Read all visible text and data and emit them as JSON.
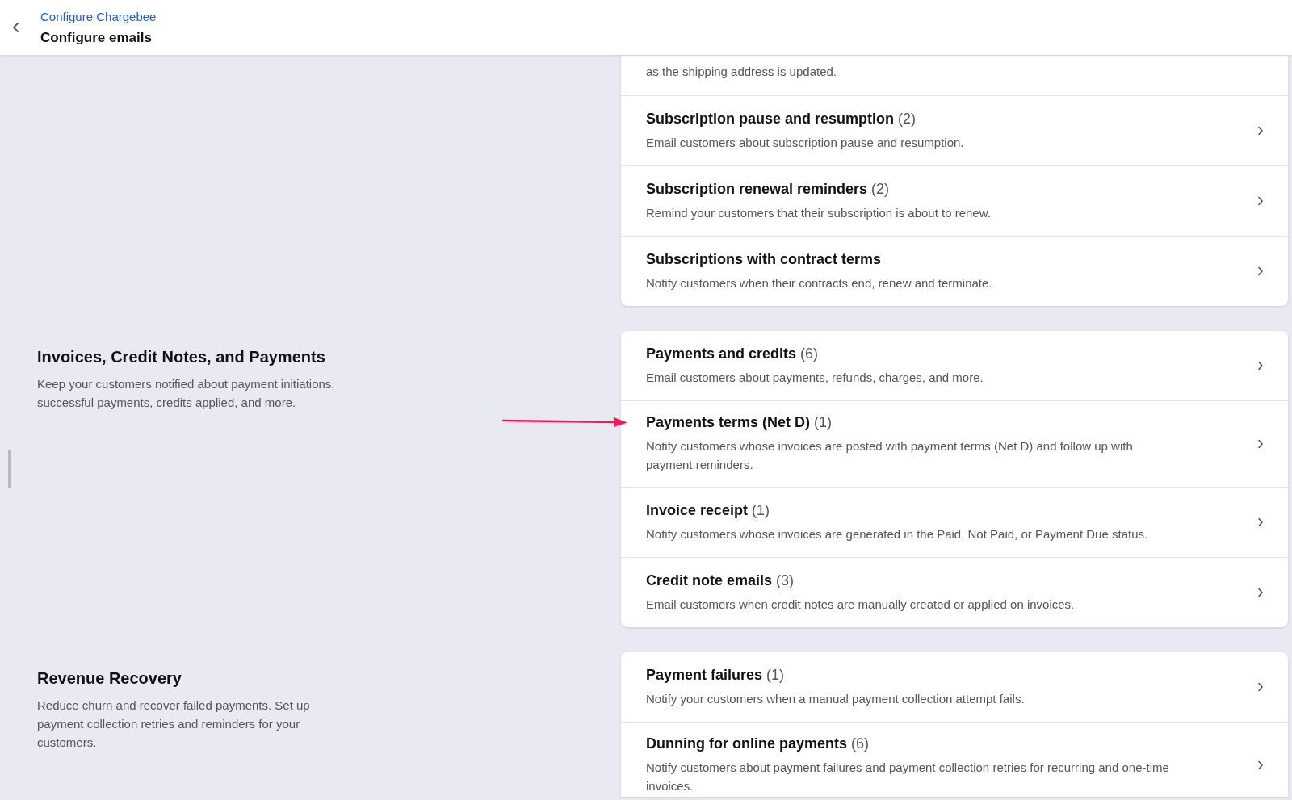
{
  "header": {
    "breadcrumb": "Configure Chargebee",
    "title": "Configure emails"
  },
  "sections": [
    {
      "rows": [
        {
          "kind": "fragment",
          "description": "as the shipping address is updated."
        },
        {
          "kind": "item",
          "title": "Subscription pause and resumption",
          "count": "(2)",
          "description": "Email customers about subscription pause and resumption.",
          "highlighted": false
        },
        {
          "kind": "item",
          "title": "Subscription renewal reminders",
          "count": "(2)",
          "description": "Remind your customers that their subscription is about to renew.",
          "highlighted": false
        },
        {
          "kind": "item",
          "title": "Subscriptions with contract terms",
          "description": "Notify customers when their contracts end, renew and terminate.",
          "highlighted": false
        }
      ]
    },
    {
      "title": "Invoices, Credit Notes, and Payments",
      "description": "Keep your customers notified about payment initiations, successful payments, credits applied, and more.",
      "rows": [
        {
          "kind": "item",
          "title": "Payments and credits",
          "count": "(6)",
          "description": "Email customers about payments, refunds, charges, and more.",
          "highlighted": false
        },
        {
          "kind": "item",
          "title": "Payments terms (Net D)",
          "count": "(1)",
          "description": "Notify customers whose invoices are posted with payment terms (Net D) and follow up with payment reminders.",
          "highlighted": true
        },
        {
          "kind": "item",
          "title": "Invoice receipt",
          "count": "(1)",
          "description": "Notify customers whose invoices are generated in the Paid, Not Paid, or Payment Due status.",
          "highlighted": false
        },
        {
          "kind": "item",
          "title": "Credit note emails",
          "count": "(3)",
          "description": "Email customers when credit notes are manually created or applied on invoices.",
          "highlighted": false
        }
      ]
    },
    {
      "title": "Revenue Recovery",
      "description": "Reduce churn and recover failed payments. Set up payment collection retries and reminders for your customers.",
      "rows": [
        {
          "kind": "item",
          "title": "Payment failures",
          "count": "(1)",
          "description": "Notify your customers when a manual payment collection attempt fails.",
          "highlighted": false
        },
        {
          "kind": "item",
          "title": "Dunning for online payments",
          "count": "(6)",
          "description": "Notify customers about payment failures and payment collection retries for recurring and one-time invoices.",
          "highlighted": false
        }
      ]
    }
  ]
}
